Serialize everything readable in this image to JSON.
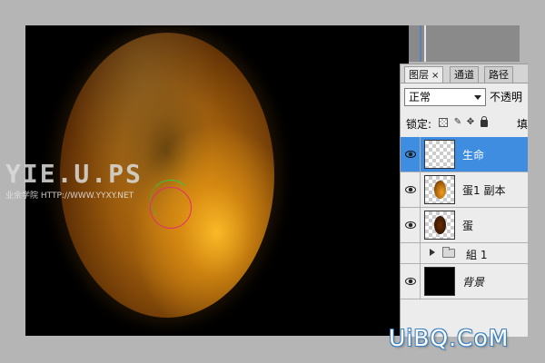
{
  "watermark": {
    "big": "YIE.U.PS",
    "small": "业余学院 HTTP://WWW.YYXY.NET"
  },
  "layers_panel": {
    "tabs": [
      {
        "label": "图层",
        "close": "×"
      },
      {
        "label": "通道"
      },
      {
        "label": "路径"
      }
    ],
    "blend_mode": "正常",
    "opacity_label": "不透明",
    "lock_label": "锁定:",
    "fill_label": "填",
    "layers": [
      {
        "name": "生命",
        "visible": true,
        "selected": true,
        "thumb": "transparent"
      },
      {
        "name": "蛋1 副本",
        "visible": true,
        "selected": false,
        "thumb": "gold-egg"
      },
      {
        "name": "蛋",
        "visible": true,
        "selected": false,
        "thumb": "brown-egg"
      },
      {
        "name": "組 1",
        "visible": false,
        "selected": false,
        "thumb": "folder"
      },
      {
        "name": "背景",
        "visible": true,
        "selected": false,
        "thumb": "black"
      }
    ]
  },
  "icons": {
    "eye": "eye-icon",
    "lock_transparent": "lock-transparent-icon",
    "lock_brush": "brush-icon",
    "lock_move": "move-icon",
    "lock_all": "lock-icon",
    "folder": "folder-icon"
  },
  "colors": {
    "selection_blue": "#3e8de0",
    "canvas_bg": "#000000",
    "app_bg": "#b5b5b5",
    "brush_ring": "#e3306b",
    "brush_arc": "#2ecc40"
  },
  "brand": "UiBQ.CoM"
}
